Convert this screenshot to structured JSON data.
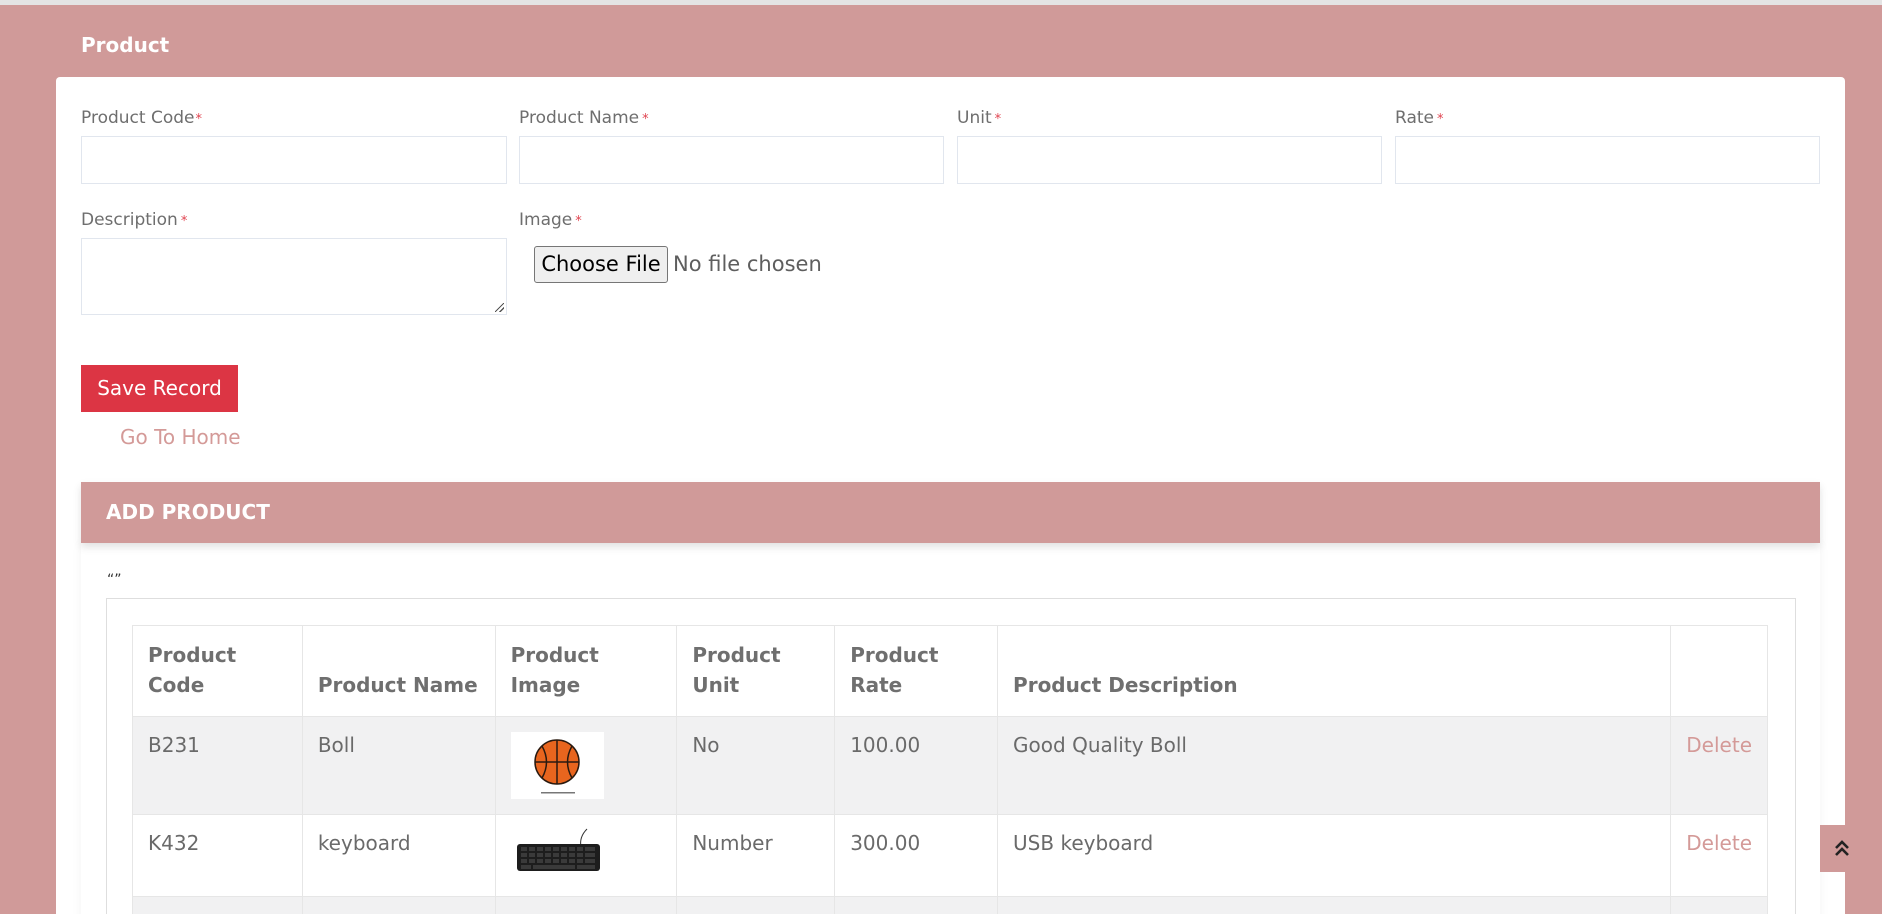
{
  "page": {
    "title": "Product"
  },
  "form": {
    "fields": [
      {
        "label": "Product Code",
        "required": "*",
        "value": ""
      },
      {
        "label": "Product Name",
        "required": "*",
        "value": ""
      },
      {
        "label": "Unit",
        "required": "*",
        "value": ""
      },
      {
        "label": "Rate",
        "required": "*",
        "value": ""
      }
    ],
    "description": {
      "label": "Description",
      "required": "*",
      "value": ""
    },
    "image": {
      "label": "Image",
      "required": "*",
      "button": "Choose File",
      "status": "No file chosen"
    },
    "save_label": "Save Record",
    "home_link": "Go To Home"
  },
  "panel": {
    "title": "ADD PRODUCT",
    "stray_text": "“”"
  },
  "table": {
    "headers": {
      "code": "Product Code",
      "name": "Product Name",
      "image": "Product Image",
      "unit": "Product Unit",
      "rate": "Product Rate",
      "description": "Product Description"
    },
    "rows": [
      {
        "code": "B231",
        "name": "Boll",
        "image_icon": "basketball-icon",
        "unit": "No",
        "rate": "100.00",
        "description": "Good Quality Boll",
        "action": "Delete"
      },
      {
        "code": "K432",
        "name": "keyboard",
        "image_icon": "keyboard-icon",
        "unit": "Number",
        "rate": "300.00",
        "description": "USB keyboard",
        "action": "Delete"
      }
    ]
  },
  "scroll_top_icon": "double-chevron-up-icon",
  "colors": {
    "background": "#d09a99",
    "save_button": "#dc3544",
    "link": "#d49a98",
    "required": "#e0434f"
  }
}
